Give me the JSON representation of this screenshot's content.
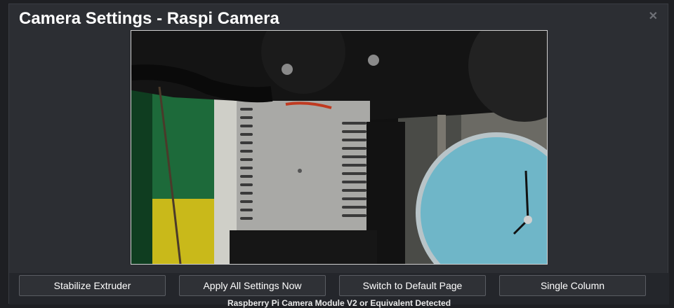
{
  "modal": {
    "title": "Camera Settings - Raspi Camera",
    "close_icon": "close-icon"
  },
  "camera": {
    "feed": "camera-feed-image"
  },
  "buttons": {
    "stabilize": "Stabilize Extruder",
    "apply": "Apply All Settings Now",
    "switch_default": "Switch to Default Page",
    "single_column": "Single Column"
  },
  "status": {
    "detected": "Raspberry Pi Camera Module V2 or Equivalent Detected"
  },
  "colors": {
    "modal_bg": "#2c2e33",
    "button_border": "#5a5d63",
    "title": "#ffffff"
  }
}
